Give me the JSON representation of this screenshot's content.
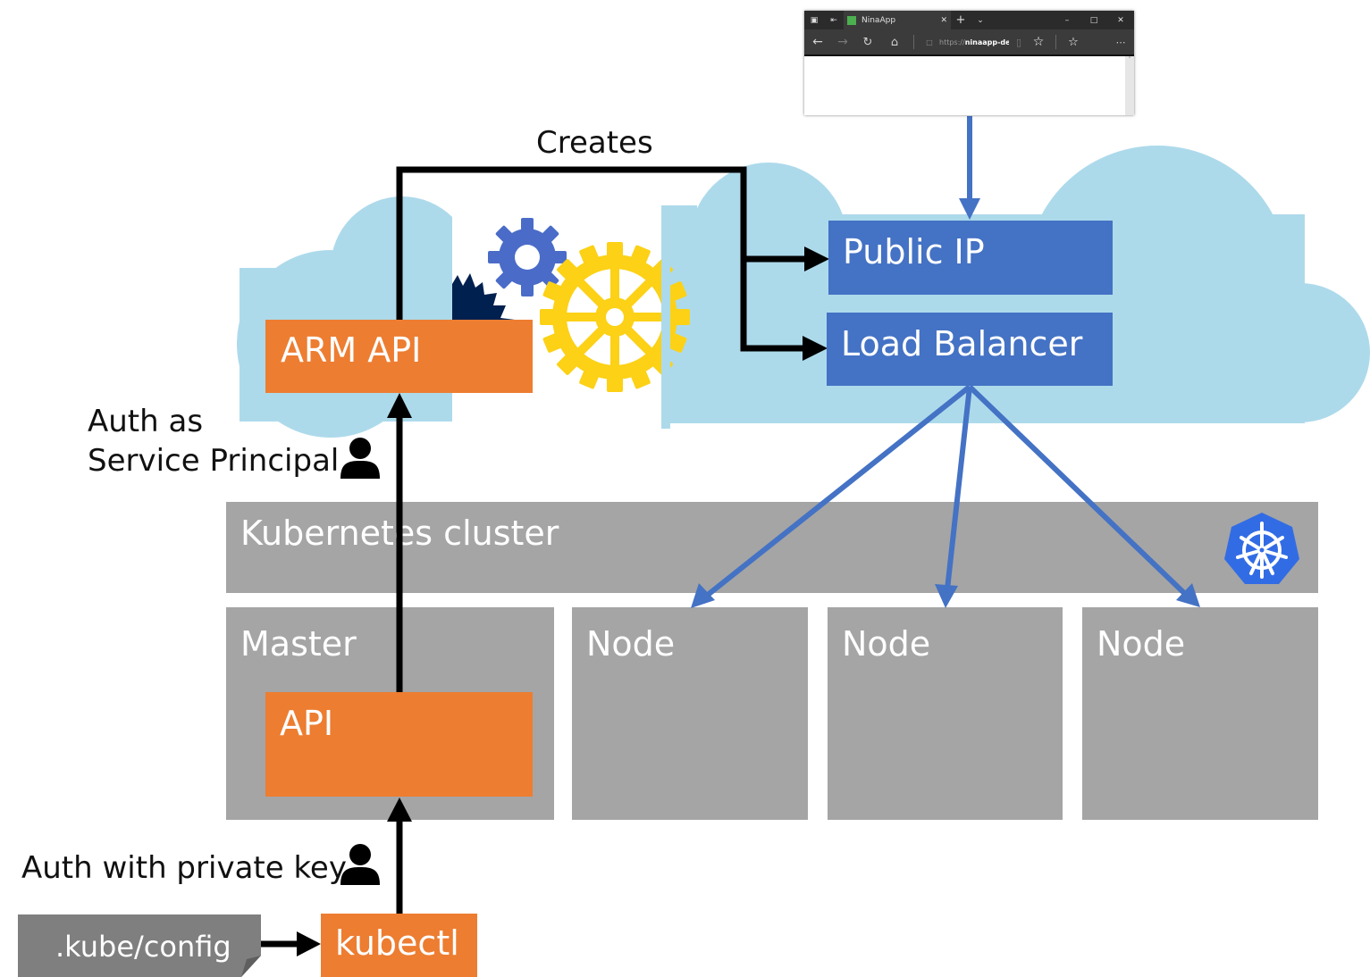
{
  "browser": {
    "tab_title": "NinaApp",
    "url": "https://ninaapp-dev",
    "url_prefix": "https://",
    "url_host": "ninaapp-dev",
    "icons": {
      "tabs": "▣",
      "set_aside": "⇤",
      "close": "✕",
      "new_tab": "+",
      "tab_list": "⌄",
      "minimize": "–",
      "maximize": "□",
      "window_close": "✕",
      "back": "←",
      "forward": "→",
      "refresh": "↻",
      "home": "⌂",
      "lock": "🔒",
      "reading_view": "▯",
      "favorite": "☆",
      "favorites_hub": "☆",
      "more": "⋯",
      "scroll_up": "˄"
    }
  },
  "labels": {
    "creates": "Creates",
    "auth_service_principal_line1": "Auth as",
    "auth_service_principal_line2": "Service Principal",
    "auth_private_key": "Auth with private key"
  },
  "boxes": {
    "arm_api": "ARM API",
    "public_ip": "Public IP",
    "load_balancer": "Load Balancer",
    "kubernetes_cluster": "Kubernetes cluster",
    "master": "Master",
    "api": "API",
    "nodes": [
      "Node",
      "Node",
      "Node"
    ],
    "kubectl": "kubectl",
    "kube_config": ".kube/config"
  },
  "colors": {
    "orange": "#ED7D31",
    "blue": "#4472C4",
    "cloud": "#ADDAEB",
    "gray": "#A5A5A5",
    "dark_gray": "#7F7F7F",
    "gear_yellow": "#FCD116",
    "gear_blue": "#4A6CC8",
    "gear_navy": "#002050",
    "k8s_blue": "#326CE5"
  }
}
